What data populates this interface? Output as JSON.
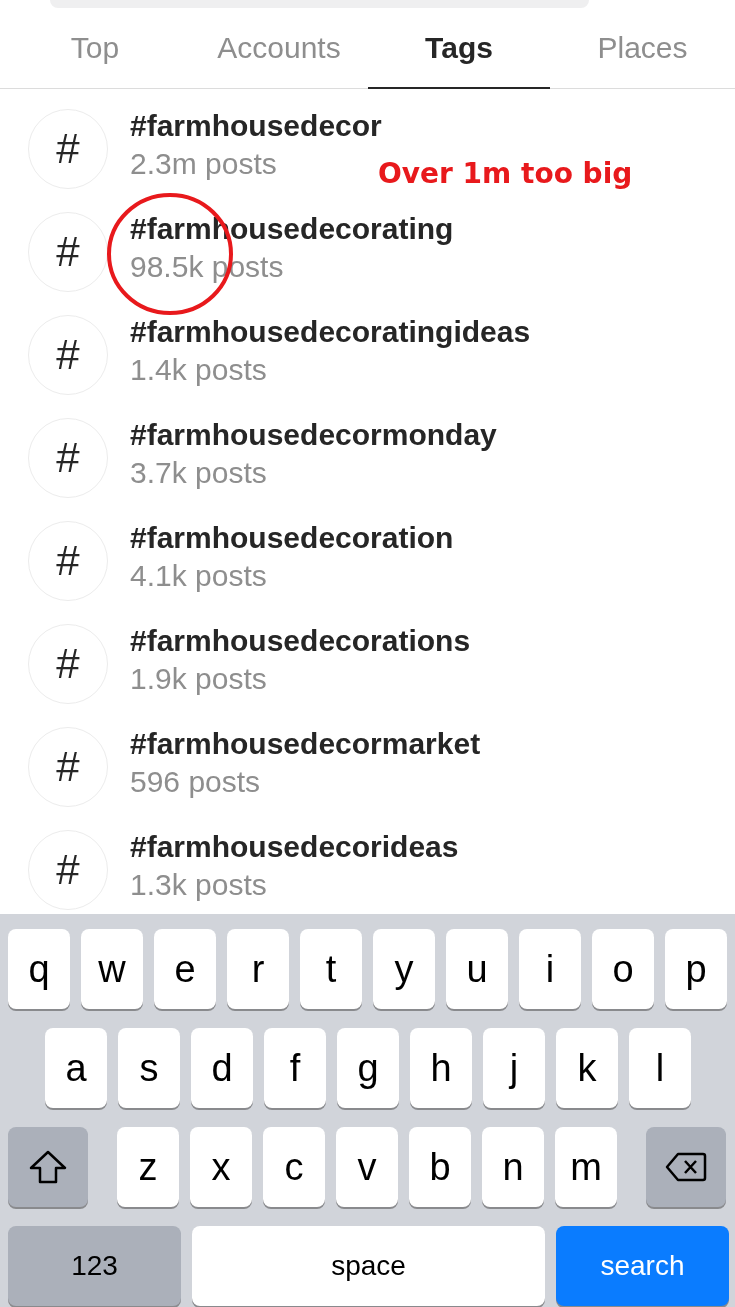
{
  "tabs": [
    {
      "label": "Top",
      "selected": false
    },
    {
      "label": "Accounts",
      "selected": false
    },
    {
      "label": "Tags",
      "selected": true
    },
    {
      "label": "Places",
      "selected": false
    }
  ],
  "results": [
    {
      "icon": "#",
      "title": "#farmhousedecor",
      "subtitle": "2.3m posts"
    },
    {
      "icon": "#",
      "title": "#farmhousedecorating",
      "subtitle": "98.5k posts",
      "circled": true
    },
    {
      "icon": "#",
      "title": "#farmhousedecoratingideas",
      "subtitle": "1.4k posts"
    },
    {
      "icon": "#",
      "title": "#farmhousedecormonday",
      "subtitle": "3.7k posts"
    },
    {
      "icon": "#",
      "title": "#farmhousedecoration",
      "subtitle": "4.1k posts"
    },
    {
      "icon": "#",
      "title": "#farmhousedecorations",
      "subtitle": "1.9k posts"
    },
    {
      "icon": "#",
      "title": "#farmhousedecormarket",
      "subtitle": "596 posts"
    },
    {
      "icon": "#",
      "title": "#farmhousedecorideas",
      "subtitle": "1.3k posts"
    }
  ],
  "annotation": {
    "text": "Over 1m too big"
  },
  "keyboard": {
    "rows": [
      [
        {
          "kind": "letter",
          "label": "q"
        },
        {
          "kind": "letter",
          "label": "w"
        },
        {
          "kind": "letter",
          "label": "e"
        },
        {
          "kind": "letter",
          "label": "r"
        },
        {
          "kind": "letter",
          "label": "t"
        },
        {
          "kind": "letter",
          "label": "y"
        },
        {
          "kind": "letter",
          "label": "u"
        },
        {
          "kind": "letter",
          "label": "i"
        },
        {
          "kind": "letter",
          "label": "o"
        },
        {
          "kind": "letter",
          "label": "p"
        }
      ],
      [
        {
          "kind": "letter",
          "label": "a"
        },
        {
          "kind": "letter",
          "label": "s"
        },
        {
          "kind": "letter",
          "label": "d"
        },
        {
          "kind": "letter",
          "label": "f"
        },
        {
          "kind": "letter",
          "label": "g"
        },
        {
          "kind": "letter",
          "label": "h"
        },
        {
          "kind": "letter",
          "label": "j"
        },
        {
          "kind": "letter",
          "label": "k"
        },
        {
          "kind": "letter",
          "label": "l"
        }
      ],
      [
        {
          "kind": "shift"
        },
        {
          "kind": "letter",
          "label": "z"
        },
        {
          "kind": "letter",
          "label": "x"
        },
        {
          "kind": "letter",
          "label": "c"
        },
        {
          "kind": "letter",
          "label": "v"
        },
        {
          "kind": "letter",
          "label": "b"
        },
        {
          "kind": "letter",
          "label": "n"
        },
        {
          "kind": "letter",
          "label": "m"
        },
        {
          "kind": "backspace"
        }
      ]
    ],
    "bottom_bar": [
      {
        "kind": "numbers",
        "label": "123"
      },
      {
        "kind": "space",
        "label": "space"
      },
      {
        "kind": "search",
        "label": "search"
      }
    ]
  }
}
